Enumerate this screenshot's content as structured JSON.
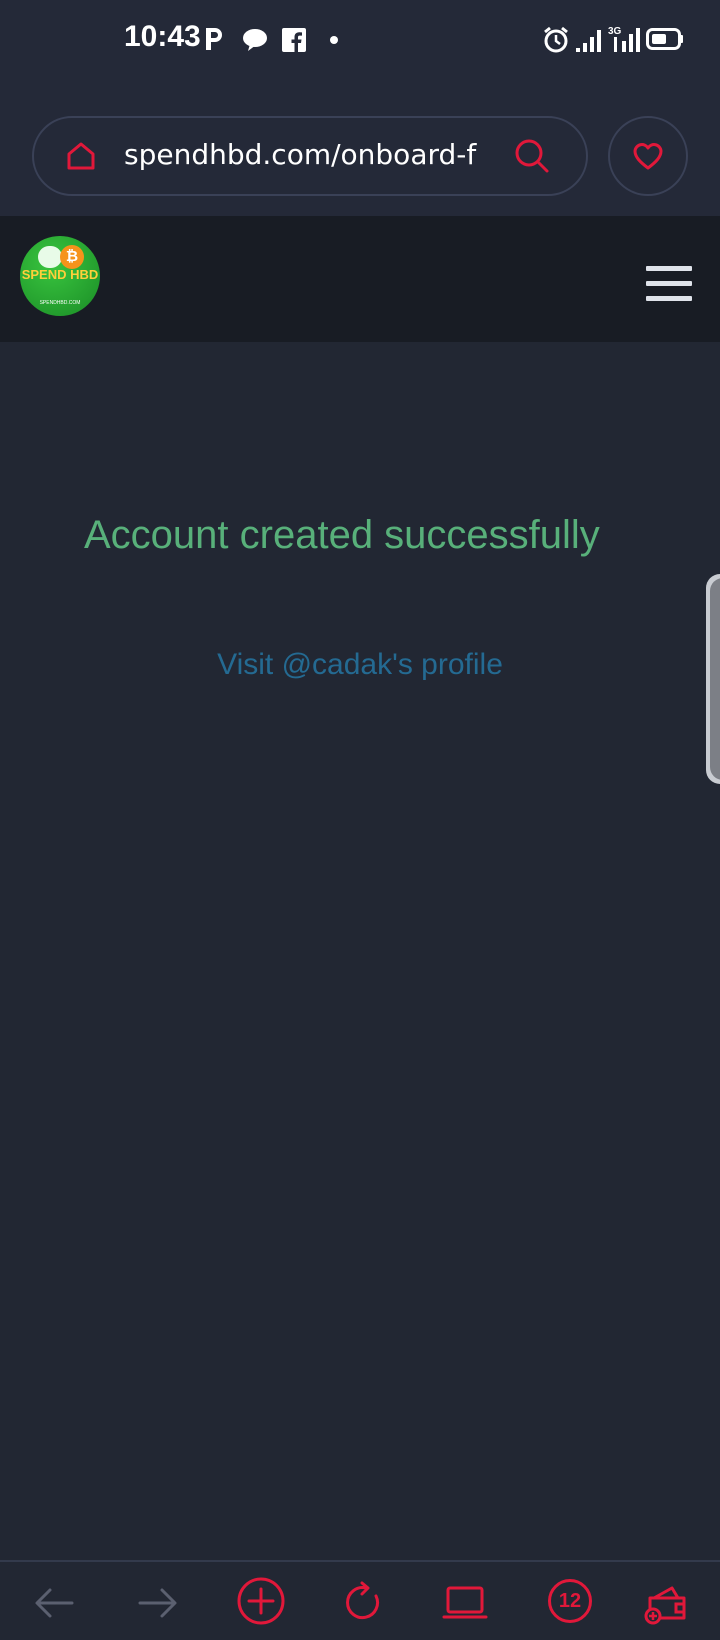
{
  "status_bar": {
    "time": "10:43",
    "icons": [
      "p-icon",
      "chat-bubble-icon",
      "facebook-icon",
      "dot-icon",
      "alarm-icon",
      "signal-icon",
      "3g-signal-icon",
      "battery-icon"
    ]
  },
  "browser": {
    "url": "spendhbd.com/onboard-f",
    "icons": [
      "home-icon",
      "search-icon",
      "heart-icon"
    ]
  },
  "site": {
    "logo_text": "SPEND HBD",
    "logo_coin": "₿",
    "logo_small": "SPENDHBD.COM",
    "menu_icon": "hamburger-menu-icon"
  },
  "main": {
    "heading": "Account created successfully",
    "profile_link": "Visit @cadak's profile"
  },
  "bottom_bar": {
    "tab_count": "12",
    "icons": [
      "back-arrow-icon",
      "forward-arrow-icon",
      "new-tab-icon",
      "reload-icon",
      "desktop-mode-icon",
      "tab-count",
      "wallet-icon"
    ]
  },
  "colors": {
    "background": "#222733",
    "header": "#181c24",
    "accent_red": "#e1183a",
    "success_green": "#58b07a",
    "link_blue": "#246a92"
  }
}
